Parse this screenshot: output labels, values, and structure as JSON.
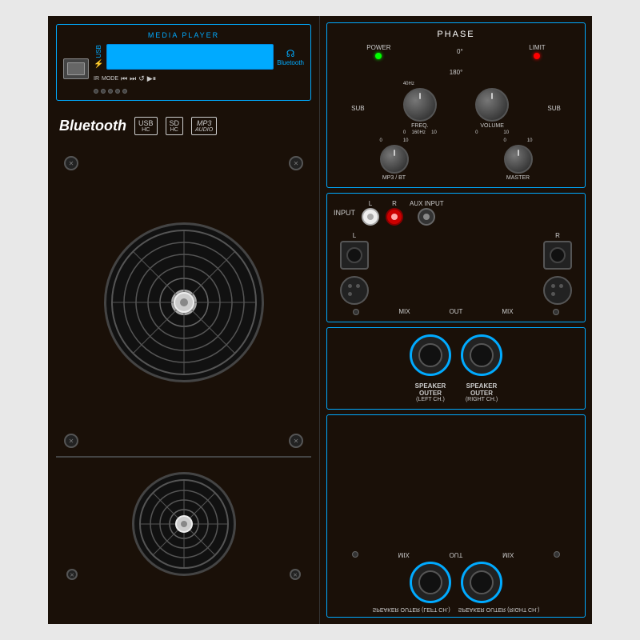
{
  "device": {
    "title": "MEDIA PLAYER",
    "phase": {
      "title": "PHASE",
      "power_label": "POWER",
      "degree0_label": "0°",
      "limit_label": "LIMIT",
      "degree180_label": "180°",
      "sub_label": "SUB",
      "freq_label": "FREQ.",
      "volume_label": "VOLUME",
      "scale_40hz": "40Hz",
      "scale_160hz": "160Hz",
      "scale_0_left": "0",
      "scale_10_freq": "10",
      "scale_0_vol": "0",
      "scale_10_vol": "10",
      "mp3bt_label": "MP3 / BT",
      "master_label": "MASTER",
      "scale_0_mp3": "0",
      "scale_10_mp3": "10",
      "scale_0_mast": "0",
      "scale_10_mast": "10"
    },
    "input": {
      "input_label": "INPUT",
      "l_label": "L",
      "r_label": "R",
      "aux_label": "AUX INPUT",
      "left_jack_label": "L",
      "right_jack_label": "R",
      "mix_label_left": "MIX",
      "out_label": "OUT",
      "mix_label_right": "MIX"
    },
    "speaker": {
      "left_label": "SPEAKER OUTER",
      "left_ch": "(LEFT CH.)",
      "right_label": "SPEAKER OUTER",
      "right_ch": "(RIGHT CH.)"
    },
    "media": {
      "usb_label": "USB",
      "bluetooth_label": "Bluetooth",
      "ir_label": "IR",
      "mode_label": "MODE"
    },
    "icons": {
      "bluetooth": "Bluetooth",
      "usb_badge": "USB",
      "usb_sub": "HC",
      "sd_badge": "SD",
      "sd_sub": "HC",
      "mp3_badge": "MP3",
      "mp3_sub": "AUDIO"
    }
  }
}
